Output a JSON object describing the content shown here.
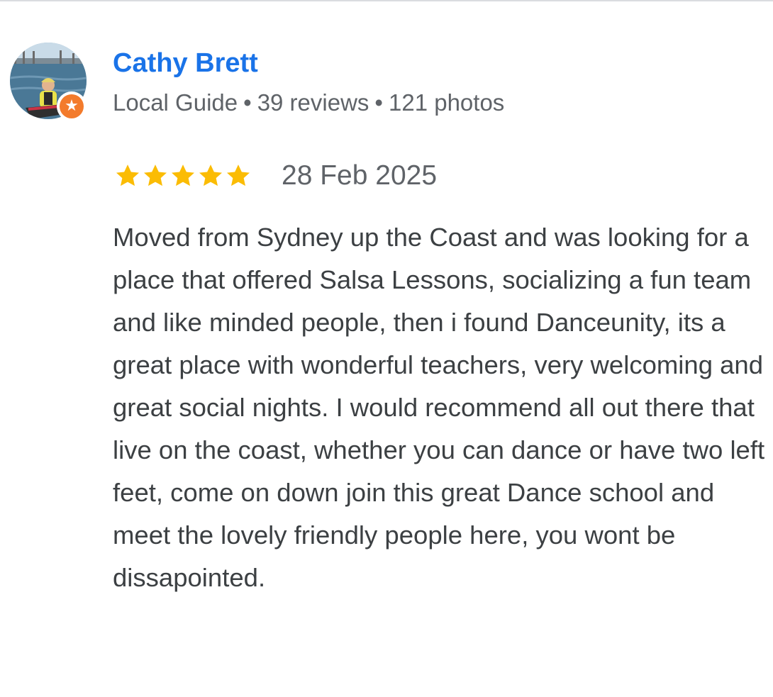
{
  "reviewer": {
    "name": "Cathy Brett",
    "badge": "Local Guide",
    "separator": "•",
    "reviews_count": "39 reviews",
    "photos_count": "121 photos",
    "badge_color": "#f37b2c",
    "name_color": "#1a73e8"
  },
  "review": {
    "rating": 5,
    "max_rating": 5,
    "star_color": "#fbbc04",
    "date": "28 Feb 2025",
    "text": "Moved from Sydney up the Coast and was looking for a place that offered Salsa Lessons, socializing a fun team and like minded people, then i found Danceunity, its a great place with wonderful teachers, very welcoming and great social nights. I would recommend all out there that live on the coast, whether you can dance or have two left feet, come on down join this great Dance school and meet the lovely friendly people here, you wont be dissapointed."
  }
}
